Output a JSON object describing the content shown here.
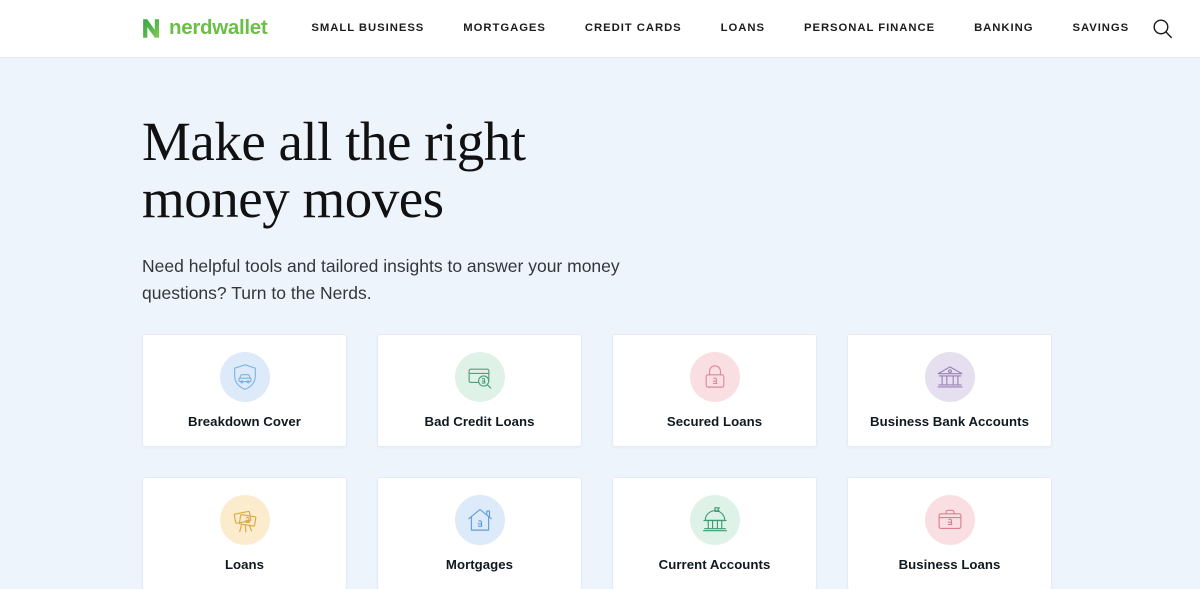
{
  "colors": {
    "page_background": "#eef4fc",
    "header_background": "#ffffff",
    "brand_green": "#6bbf47",
    "card_background": "#ffffff",
    "card_border": "#e3ecf6",
    "headline_color": "#111111"
  },
  "header": {
    "brand_name": "nerdwallet",
    "brand_icon": "nerdwallet-n-logo-icon",
    "nav_items": [
      {
        "label": "SMALL BUSINESS",
        "name": "small-business"
      },
      {
        "label": "MORTGAGES",
        "name": "mortgages"
      },
      {
        "label": "CREDIT CARDS",
        "name": "credit-cards"
      },
      {
        "label": "LOANS",
        "name": "loans"
      },
      {
        "label": "PERSONAL FINANCE",
        "name": "personal-finance"
      },
      {
        "label": "BANKING",
        "name": "banking"
      },
      {
        "label": "SAVINGS",
        "name": "savings"
      }
    ],
    "search_icon": "search-icon"
  },
  "hero": {
    "headline": "Make all the right money moves",
    "subheading": "Need helpful tools and tailored insights to answer your money questions? Turn to the Nerds."
  },
  "cards": [
    {
      "label": "Breakdown Cover",
      "icon": "shield-car-icon",
      "circle_color": "#dceafa",
      "stroke_color": "#7fb3e0"
    },
    {
      "label": "Bad Credit Loans",
      "icon": "credit-card-magnifier-pound-icon",
      "circle_color": "#dff2e8",
      "stroke_color": "#49a27a"
    },
    {
      "label": "Secured Loans",
      "icon": "padlock-pound-icon",
      "circle_color": "#fadfe2",
      "stroke_color": "#db8b98"
    },
    {
      "label": "Business Bank Accounts",
      "icon": "bank-columns-icon",
      "circle_color": "#e6dff0",
      "stroke_color": "#9b82b5"
    },
    {
      "label": "Loans",
      "icon": "banknotes-pound-icon",
      "circle_color": "#fbeccd",
      "stroke_color": "#d6a944"
    },
    {
      "label": "Mortgages",
      "icon": "house-pound-icon",
      "circle_color": "#dceafa",
      "stroke_color": "#5e9ed6"
    },
    {
      "label": "Current Accounts",
      "icon": "domed-bank-flag-icon",
      "circle_color": "#dff2e8",
      "stroke_color": "#3f9a74"
    },
    {
      "label": "Business Loans",
      "icon": "briefcase-pound-icon",
      "circle_color": "#fadfe2",
      "stroke_color": "#d9808f"
    }
  ]
}
